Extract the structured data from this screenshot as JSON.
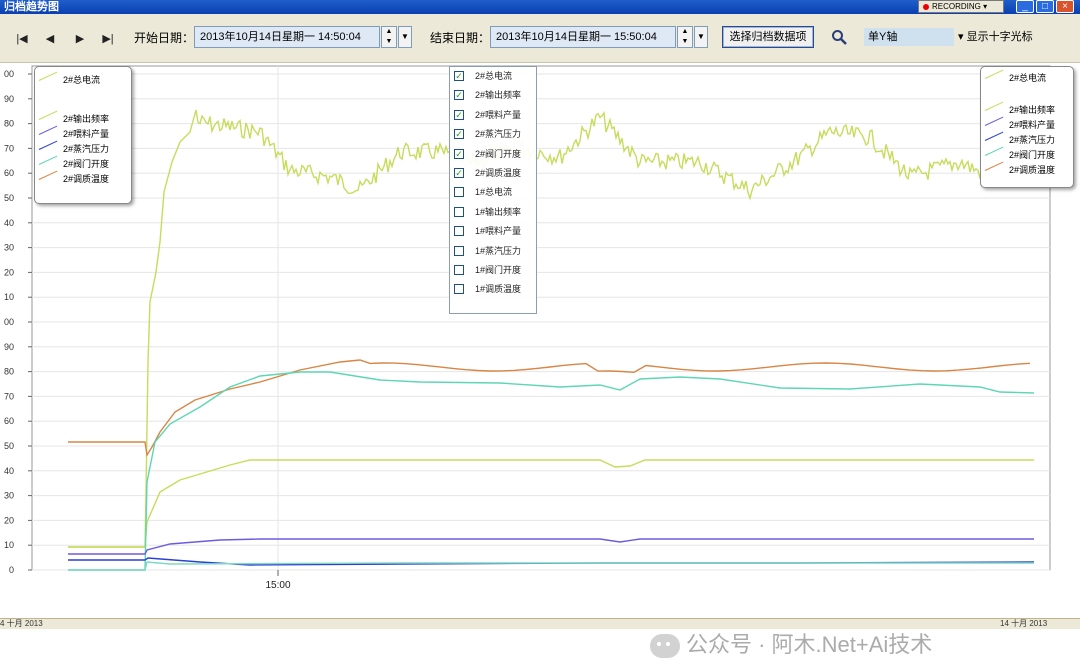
{
  "window": {
    "title": "归档趋势图",
    "recording_label": "RECORDING",
    "controls": [
      "_",
      "□",
      "×"
    ]
  },
  "toolbar": {
    "nav_buttons": [
      "|◀",
      "◀",
      "▶",
      "▶|"
    ],
    "start_label": "开始日期：",
    "start_value": "2013年10月14日星期一  14:50:04",
    "end_label": "结束日期：",
    "end_value": "2013年10月14日星期一  15:50:04",
    "select_button": "选择归档数据项",
    "axis_value": "单Y轴",
    "crosshair_label": "显示十字光标"
  },
  "axis": {
    "y_ticks": [
      "00",
      "90",
      "80",
      "70",
      "60",
      "50",
      "40",
      "30",
      "20",
      "10",
      "00",
      "90",
      "80",
      "70",
      "60",
      "50",
      "40",
      "30",
      "20",
      "10",
      "0"
    ],
    "x_tick": "15:00",
    "bottom_left": "4  十月  2013",
    "bottom_right": "14  十月  2013"
  },
  "legend_left": [
    {
      "label": "2#总电流",
      "color": "#c7dc5c"
    },
    {
      "label": "2#输出频率",
      "color": "#c7dc5c"
    },
    {
      "label": "2#喂料产量",
      "color": "#6b5ce0"
    },
    {
      "label": "2#蒸汽压力",
      "color": "#2a3fd4"
    },
    {
      "label": "2#阀门开度",
      "color": "#5ed6b4"
    },
    {
      "label": "2#调质温度",
      "color": "#d98545"
    }
  ],
  "legend_right": [
    {
      "label": "2#总电流",
      "color": "#c7dc5c"
    },
    {
      "label": "2#输出频率",
      "color": "#c7dc5c"
    },
    {
      "label": "2#喂料产量",
      "color": "#6b5ce0"
    },
    {
      "label": "2#蒸汽压力",
      "color": "#2a3fd4"
    },
    {
      "label": "2#阀门开度",
      "color": "#5ed6b4"
    },
    {
      "label": "2#调质温度",
      "color": "#d98545"
    }
  ],
  "series_dropdown": [
    {
      "label": "2#总电流",
      "checked": true
    },
    {
      "label": "2#输出频率",
      "checked": true
    },
    {
      "label": "2#喂料产量",
      "checked": true
    },
    {
      "label": "2#蒸汽压力",
      "checked": true
    },
    {
      "label": "2#阀门开度",
      "checked": true
    },
    {
      "label": "2#调质温度",
      "checked": true
    },
    {
      "label": "1#总电流",
      "checked": false
    },
    {
      "label": "1#输出频率",
      "checked": false
    },
    {
      "label": "1#喂料产量",
      "checked": false
    },
    {
      "label": "1#蒸汽压力",
      "checked": false
    },
    {
      "label": "1#阀门开度",
      "checked": false
    },
    {
      "label": "1#调质温度",
      "checked": false
    }
  ],
  "watermark": "公众号 · 阿木.Net+Ai技术"
}
